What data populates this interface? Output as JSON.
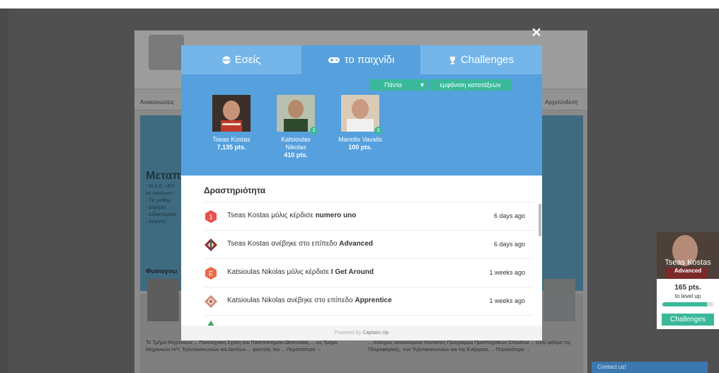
{
  "colors": {
    "accent": "#55a0dd",
    "tab_inactive": "#74b6e9",
    "green": "#3ab99a",
    "overlay": "#505050"
  },
  "background_site": {
    "nav_left": "Ανακοινώσεις",
    "nav_right": "Αρχισύνδεση",
    "banner_title": "Μεταπ",
    "banner_lines": [
      "- Μ.Δ.Ε. «Επ",
      "κα Δικτύων»",
      "- Τίς μαθημ",
      "- Δόμηση",
      "- Διδακτορικές",
      "- Δόμηση"
    ],
    "section_heading": "Φυσιογνω",
    "text_left": "Το Τμήμα Μηχανικών ... Πολυτεχνική Σχολή του Πανεπιστημίου Θεσσαλίας ... ως Τμήμα Μηχανικών Η/Υ, Τηλεπικοινωνιών και Δικτύων ... φοιτητές του ... Περισσότερα →",
    "text_right": "... συνεχώς ανανεούμενο πενταετές Πρόγραμμα Προπτυχιακών Σπουδών ... ευρύ φάσμα της Πληροφορικής, των Τηλεπικοινωνιών και της Ενέργειας ... Περισσότερα →"
  },
  "modal": {
    "close_icon": "close-icon",
    "tabs": [
      {
        "label": "Εσείς",
        "icon": "face-icon"
      },
      {
        "label": "το παιχνίδι",
        "icon": "controller-icon"
      },
      {
        "label": "Challenges",
        "icon": "trophy-icon"
      }
    ],
    "filter_value": "Πάντα",
    "achievements_button": "εμφάνιση κατατάξεων",
    "leaderboard": [
      {
        "name": "Tseas Kostas",
        "points": "7,135 pts.",
        "rank": ""
      },
      {
        "name": "Katsioulas Nikolas",
        "points": "410 pts.",
        "rank": "2"
      },
      {
        "name": "Manolis Vavalis",
        "points": "100 pts.",
        "rank": "3"
      }
    ],
    "activity_title": "Δραστηριότητα",
    "activity": [
      {
        "user": "Tseas Kostas",
        "action": " μόλις κέρδισε ",
        "target": "numero uno",
        "time": "6 days ago",
        "icon": "hexagon-badge-1-icon",
        "icon_color": "#e8504f"
      },
      {
        "user": "Tseas Kostas",
        "action": " ανέβηκε στο επίπεδο ",
        "target": "Advanced",
        "time": "6 days ago",
        "icon": "level-diamond-icon",
        "icon_color": "#8b2c2c"
      },
      {
        "user": "Katsioulas Nikolas",
        "action": " μόλις κέρδισε ",
        "target": "I Get Around",
        "time": "1 weeks ago",
        "icon": "hexagon-badge-e-icon",
        "icon_color": "#e86a4a"
      },
      {
        "user": "Katsioulas Nikolas",
        "action": " ανέβηκε στο επίπεδο ",
        "target": "Apprentice",
        "time": "1 weeks ago",
        "icon": "level-diamond-icon",
        "icon_color": "#d08a7a"
      }
    ],
    "footer_prefix": "Powered By ",
    "footer_brand": "Captain Up"
  },
  "widget": {
    "name": "Tseas Kostas",
    "level": "Advanced",
    "points": "165 pts.",
    "to_level": "to level up",
    "progress": 0.88,
    "button": "Challenges"
  },
  "contact_label": "Contact us!"
}
